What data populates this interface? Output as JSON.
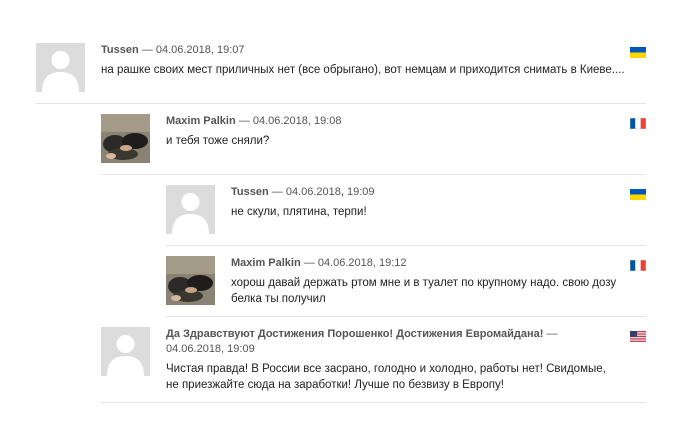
{
  "comments": [
    {
      "author": "Tussen",
      "separator": " — ",
      "date": "04.06.2018, 19:07",
      "text": "на рашке своих мест приличных нет (все обрыгано), вот немцам и приходится снимать в Киеве....",
      "avatar": "default-avatar",
      "flag": "ukraine-flag",
      "colors": [
        "#0057b7",
        "#ffd700"
      ]
    },
    {
      "author": "Maxim Palkin",
      "separator": " — ",
      "date": "04.06.2018, 19:08",
      "text": "и тебя тоже сняли?",
      "avatar": "photo-avatar",
      "flag": "france-flag",
      "colors": [
        "#0055a4",
        "#ffffff",
        "#ef4135"
      ]
    },
    {
      "author": "Tussen",
      "separator": " — ",
      "date": "04.06.2018, 19:09",
      "text": "не скули, плятина, терпи!",
      "avatar": "default-avatar",
      "flag": "ukraine-flag",
      "colors": [
        "#0057b7",
        "#ffd700"
      ]
    },
    {
      "author": "Maxim Palkin",
      "separator": " — ",
      "date": "04.06.2018, 19:12",
      "text": "хорош давай держать ртом мне и в туалет по крупному надо. свою дозу белка ты получил",
      "avatar": "photo-avatar",
      "flag": "france-flag",
      "colors": [
        "#0055a4",
        "#ffffff",
        "#ef4135"
      ]
    },
    {
      "author": "Да Здравствуют Достижения Порошенко! Достижения Евромайдана!",
      "separator": " — ",
      "date": "04.06.2018, 19:09",
      "text": "Чистая правда! В России все засрано, голодно и холодно, работы нет! Свидомые, не приезжайте сюда на заработки! Лучше по безвизу в Европу!",
      "avatar": "default-avatar",
      "flag": "usa-flag",
      "colors": [
        "#b22234",
        "#ffffff",
        "#3c3b6e"
      ]
    }
  ]
}
